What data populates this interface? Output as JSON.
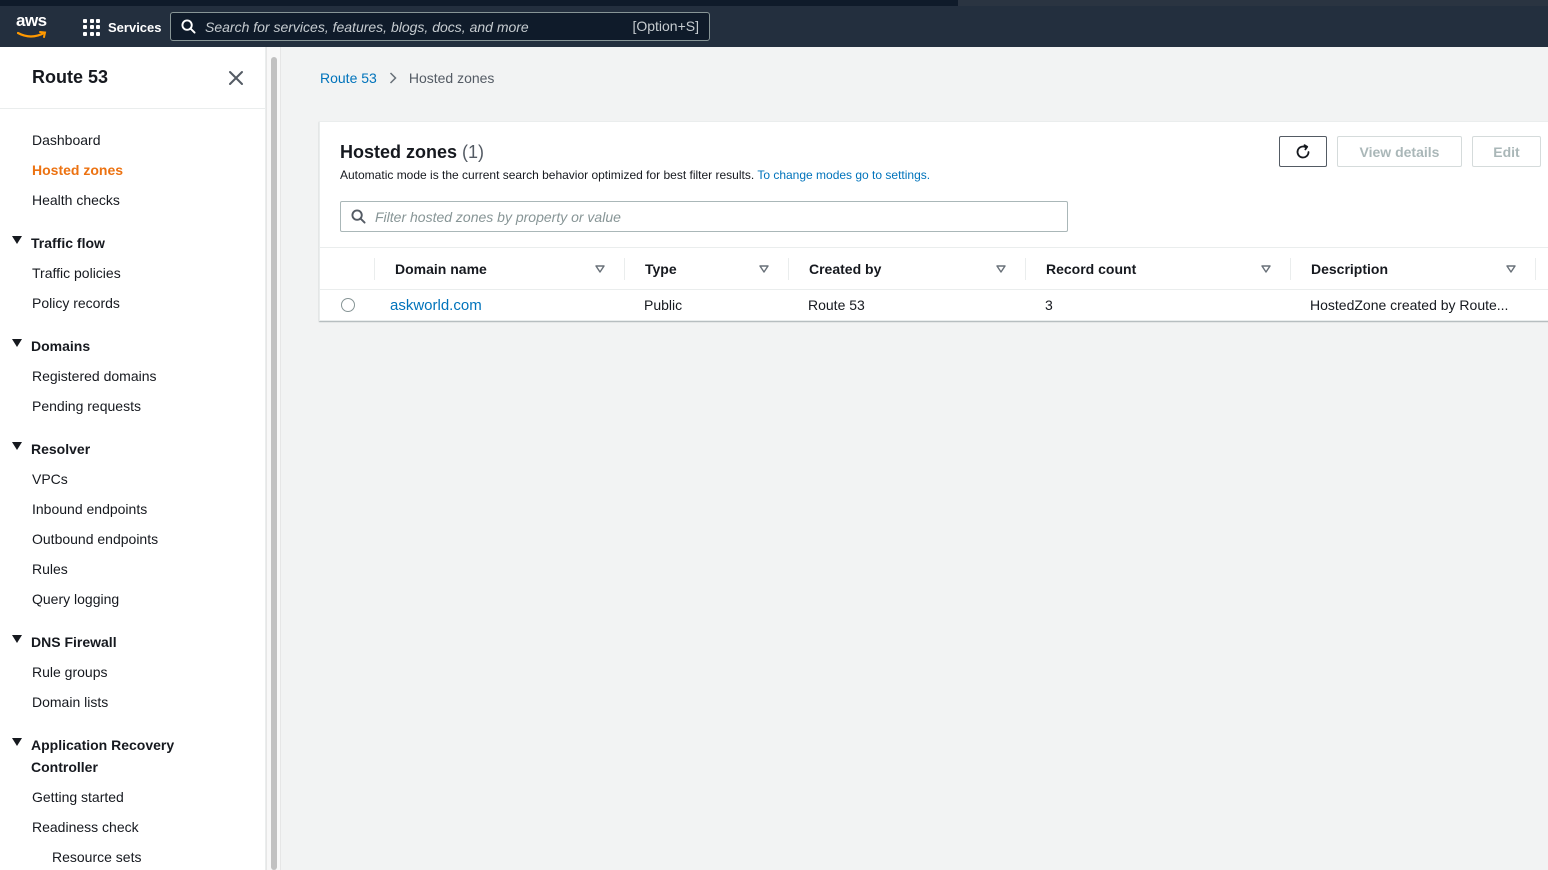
{
  "topbar": {
    "logo_text": "aws",
    "services_label": "Services",
    "search_placeholder": "Search for services, features, blogs, docs, and more",
    "search_shortcut": "[Option+S]"
  },
  "sidebar": {
    "title": "Route 53",
    "items": {
      "dashboard": "Dashboard",
      "hosted_zones": "Hosted zones",
      "health_checks": "Health checks",
      "traffic_flow": "Traffic flow",
      "traffic_policies": "Traffic policies",
      "policy_records": "Policy records",
      "domains": "Domains",
      "registered_domains": "Registered domains",
      "pending_requests": "Pending requests",
      "resolver": "Resolver",
      "vpcs": "VPCs",
      "inbound_endpoints": "Inbound endpoints",
      "outbound_endpoints": "Outbound endpoints",
      "rules": "Rules",
      "query_logging": "Query logging",
      "dns_firewall": "DNS Firewall",
      "rule_groups": "Rule groups",
      "domain_lists": "Domain lists",
      "arc": "Application Recovery Controller",
      "getting_started": "Getting started",
      "readiness_check": "Readiness check",
      "resource_sets": "Resource sets"
    }
  },
  "breadcrumb": {
    "root": "Route 53",
    "current": "Hosted zones"
  },
  "panel": {
    "title": "Hosted zones",
    "count": "(1)",
    "description": "Automatic mode is the current search behavior optimized for best filter results.",
    "settings_link": "To change modes go to settings.",
    "view_details_label": "View details",
    "edit_label": "Edit",
    "filter_placeholder": "Filter hosted zones by property or value"
  },
  "table": {
    "columns": {
      "domain_name": "Domain name",
      "type": "Type",
      "created_by": "Created by",
      "record_count": "Record count",
      "description": "Description"
    },
    "rows": [
      {
        "domain_name": "askworld.com",
        "type": "Public",
        "created_by": "Route 53",
        "record_count": "3",
        "description": "HostedZone created by Route..."
      }
    ]
  },
  "colors": {
    "nav_bg": "#232f3e",
    "accent_active": "#ec7211",
    "link": "#0073bb"
  }
}
